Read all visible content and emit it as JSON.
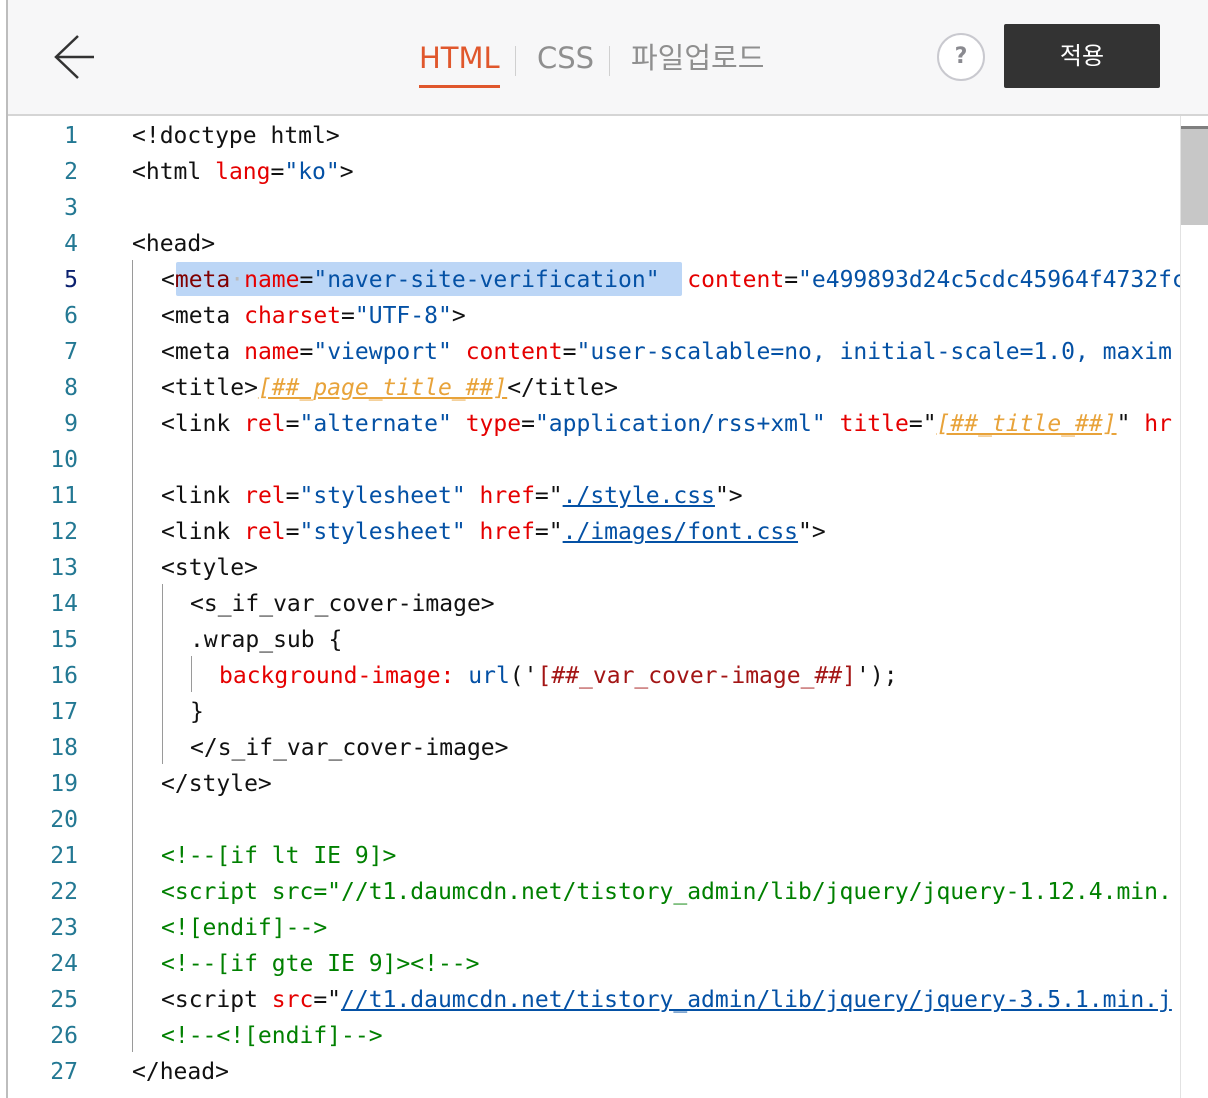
{
  "header": {
    "tabs": [
      {
        "label": "HTML",
        "active": true
      },
      {
        "label": "CSS",
        "active": false
      },
      {
        "label": "파일업로드",
        "active": false
      }
    ],
    "help_label": "?",
    "apply_label": "적용",
    "back_icon": "arrow-left-icon"
  },
  "editor": {
    "line_numbers": [
      "1",
      "2",
      "3",
      "4",
      "5",
      "6",
      "7",
      "8",
      "9",
      "10",
      "11",
      "12",
      "13",
      "14",
      "15",
      "16",
      "17",
      "18",
      "19",
      "20",
      "21",
      "22",
      "23",
      "24",
      "25",
      "26",
      "27"
    ],
    "current_line": 5,
    "lines": [
      {
        "n": 1,
        "segments": [
          {
            "t": "<!doctype html>",
            "c": "tagn"
          }
        ]
      },
      {
        "n": 2,
        "segments": [
          {
            "t": "<html ",
            "c": "tagn"
          },
          {
            "t": "lang",
            "c": "attr"
          },
          {
            "t": "=",
            "c": "tagn"
          },
          {
            "t": "\"ko\"",
            "c": "val"
          },
          {
            "t": ">",
            "c": "tagn"
          }
        ]
      },
      {
        "n": 3,
        "segments": []
      },
      {
        "n": 4,
        "segments": [
          {
            "t": "<head>",
            "c": "tagn"
          }
        ]
      },
      {
        "n": 5,
        "segments": [
          {
            "t": "<",
            "c": "tagn"
          },
          {
            "t": "meta",
            "c": "tag"
          },
          {
            "t": "·",
            "c": "dot"
          },
          {
            "t": "name",
            "c": "attr"
          },
          {
            "t": "=",
            "c": "tagn"
          },
          {
            "t": "\"naver-site-verification\"",
            "c": "val"
          },
          {
            "t": "  ",
            "c": "tagn"
          },
          {
            "t": "content",
            "c": "attr"
          },
          {
            "t": "=",
            "c": "tagn"
          },
          {
            "t": "\"e499893d24c5cdc45964f4732fc",
            "c": "val"
          }
        ]
      },
      {
        "n": 6,
        "segments": [
          {
            "t": "<meta ",
            "c": "tagn"
          },
          {
            "t": "charset",
            "c": "attr"
          },
          {
            "t": "=",
            "c": "tagn"
          },
          {
            "t": "\"UTF-8\"",
            "c": "val"
          },
          {
            "t": ">",
            "c": "tagn"
          }
        ]
      },
      {
        "n": 7,
        "segments": [
          {
            "t": "<meta ",
            "c": "tagn"
          },
          {
            "t": "name",
            "c": "attr"
          },
          {
            "t": "=",
            "c": "tagn"
          },
          {
            "t": "\"viewport\"",
            "c": "val"
          },
          {
            "t": " ",
            "c": "tagn"
          },
          {
            "t": "content",
            "c": "attr"
          },
          {
            "t": "=",
            "c": "tagn"
          },
          {
            "t": "\"user-scalable=no, initial-scale=1.0, maxim",
            "c": "val"
          }
        ]
      },
      {
        "n": 8,
        "segments": [
          {
            "t": "<title>",
            "c": "tagn"
          },
          {
            "t": "[##_page_title_##]",
            "c": "tpl"
          },
          {
            "t": "</title>",
            "c": "tagn"
          }
        ]
      },
      {
        "n": 9,
        "segments": [
          {
            "t": "<link ",
            "c": "tagn"
          },
          {
            "t": "rel",
            "c": "attr"
          },
          {
            "t": "=",
            "c": "tagn"
          },
          {
            "t": "\"alternate\"",
            "c": "val"
          },
          {
            "t": " ",
            "c": "tagn"
          },
          {
            "t": "type",
            "c": "attr"
          },
          {
            "t": "=",
            "c": "tagn"
          },
          {
            "t": "\"application/rss+xml\"",
            "c": "val"
          },
          {
            "t": " ",
            "c": "tagn"
          },
          {
            "t": "title",
            "c": "attr"
          },
          {
            "t": "=\"",
            "c": "tagn"
          },
          {
            "t": "[##_title_##]",
            "c": "tpl"
          },
          {
            "t": "\" ",
            "c": "tagn"
          },
          {
            "t": "hr",
            "c": "attr"
          }
        ]
      },
      {
        "n": 10,
        "segments": []
      },
      {
        "n": 11,
        "segments": [
          {
            "t": "<link ",
            "c": "tagn"
          },
          {
            "t": "rel",
            "c": "attr"
          },
          {
            "t": "=",
            "c": "tagn"
          },
          {
            "t": "\"stylesheet\"",
            "c": "val"
          },
          {
            "t": " ",
            "c": "tagn"
          },
          {
            "t": "href",
            "c": "attr"
          },
          {
            "t": "=\"",
            "c": "tagn"
          },
          {
            "t": "./style.css",
            "c": "link"
          },
          {
            "t": "\">",
            "c": "tagn"
          }
        ]
      },
      {
        "n": 12,
        "segments": [
          {
            "t": "<link ",
            "c": "tagn"
          },
          {
            "t": "rel",
            "c": "attr"
          },
          {
            "t": "=",
            "c": "tagn"
          },
          {
            "t": "\"stylesheet\"",
            "c": "val"
          },
          {
            "t": " ",
            "c": "tagn"
          },
          {
            "t": "href",
            "c": "attr"
          },
          {
            "t": "=\"",
            "c": "tagn"
          },
          {
            "t": "./images/font.css",
            "c": "link"
          },
          {
            "t": "\">",
            "c": "tagn"
          }
        ]
      },
      {
        "n": 13,
        "segments": [
          {
            "t": "<style>",
            "c": "tagn"
          }
        ]
      },
      {
        "n": 14,
        "segments": [
          {
            "t": "<s_if_var_cover-image>",
            "c": "tagn"
          }
        ]
      },
      {
        "n": 15,
        "segments": [
          {
            "t": ".wrap_sub {",
            "c": "tagn"
          }
        ]
      },
      {
        "n": 16,
        "segments": [
          {
            "t": "background-image: ",
            "c": "prop"
          },
          {
            "t": "url",
            "c": "val"
          },
          {
            "t": "('",
            "c": "tagn"
          },
          {
            "t": "[##_var_cover-image_##]",
            "c": "strv"
          },
          {
            "t": "');",
            "c": "tagn"
          }
        ]
      },
      {
        "n": 17,
        "segments": [
          {
            "t": "}",
            "c": "tagn"
          }
        ]
      },
      {
        "n": 18,
        "segments": [
          {
            "t": "</s_if_var_cover-image>",
            "c": "tagn"
          }
        ]
      },
      {
        "n": 19,
        "segments": [
          {
            "t": "</style>",
            "c": "tagn"
          }
        ]
      },
      {
        "n": 20,
        "segments": []
      },
      {
        "n": 21,
        "segments": [
          {
            "t": "<!--[if lt IE 9]>",
            "c": "cm"
          }
        ]
      },
      {
        "n": 22,
        "segments": [
          {
            "t": "<script src=\"//t1.daumcdn.net/tistory_admin/lib/jquery/jquery-1.12.4.min.",
            "c": "cm"
          }
        ]
      },
      {
        "n": 23,
        "segments": [
          {
            "t": "<![endif]-->",
            "c": "cm"
          }
        ]
      },
      {
        "n": 24,
        "segments": [
          {
            "t": "<!--[if gte IE 9]><!-->",
            "c": "cm"
          }
        ]
      },
      {
        "n": 25,
        "segments": [
          {
            "t": "<script ",
            "c": "tagn"
          },
          {
            "t": "src",
            "c": "attr"
          },
          {
            "t": "=\"",
            "c": "tagn"
          },
          {
            "t": "//t1.daumcdn.net/tistory_admin/lib/jquery/jquery-3.5.1.min.j",
            "c": "link"
          }
        ]
      },
      {
        "n": 26,
        "segments": [
          {
            "t": "<!--<![endif]-->",
            "c": "cm"
          }
        ]
      },
      {
        "n": 27,
        "segments": [
          {
            "t": "</head>",
            "c": "tagn"
          }
        ]
      }
    ]
  },
  "colors": {
    "accent": "#e0572c",
    "apply_bg": "#333333",
    "selection": "#bcd6f6",
    "line_number": "#237893"
  }
}
